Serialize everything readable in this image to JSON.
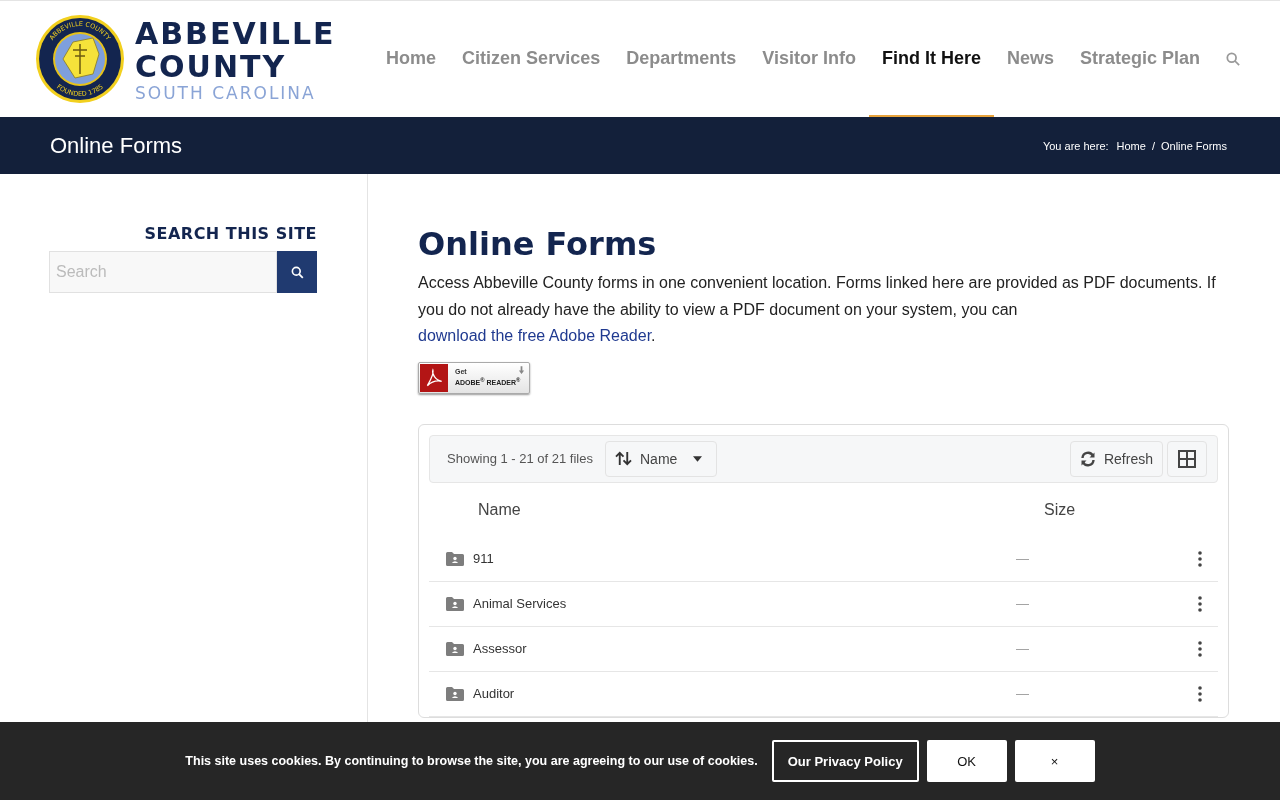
{
  "logo": {
    "seal_top": "ABBEVILLE COUNTY",
    "seal_bottom": "FOUNDED 1785",
    "line_1": "ABBEVILLE",
    "line_2": "COUNTY",
    "line_3": "SOUTH CAROLINA"
  },
  "nav": [
    {
      "label": "Home",
      "selected": false
    },
    {
      "label": "Citizen Services",
      "selected": false
    },
    {
      "label": "Departments",
      "selected": false
    },
    {
      "label": "Visitor Info",
      "selected": false
    },
    {
      "label": "Find It Here",
      "selected": true
    },
    {
      "label": "News",
      "selected": false
    },
    {
      "label": "Strategic Plan",
      "selected": false
    }
  ],
  "title_bar": {
    "title": "Online Forms",
    "breadcrumb_label": "You are here:",
    "breadcrumbs": [
      "Home",
      "Online Forms"
    ],
    "separator": "/"
  },
  "sidebar": {
    "heading": "SEARCH THIS SITE",
    "search_placeholder": "Search"
  },
  "content": {
    "heading": "Online Forms",
    "intro": "Access Abbeville County forms in one convenient location. Forms linked here are provided as PDF documents. If you do not already have the ability to view a PDF document on your system, you can ",
    "link": "download the free Adobe Reader",
    "after_link": ".",
    "adobe_badge": {
      "top": "Get",
      "bottom": "ADOBE$^{®}$ READER$^{®}$"
    }
  },
  "file_browser": {
    "count": "Showing 1 - 21 of 21 files",
    "sort": "Name",
    "refresh": "Refresh",
    "columns": [
      "Name",
      "Size"
    ],
    "rows": [
      {
        "name": "911",
        "size": "—"
      },
      {
        "name": "Animal Services",
        "size": "—"
      },
      {
        "name": "Assessor",
        "size": "—"
      },
      {
        "name": "Auditor",
        "size": "—"
      }
    ]
  },
  "cookie_bar": {
    "message": "This site uses cookies. By continuing to browse the site, you are agreeing to our use of cookies.",
    "buttons": [
      {
        "label": "Our Privacy Policy",
        "kind": "outline"
      },
      {
        "label": "OK",
        "kind": "solid"
      },
      {
        "label": "×",
        "kind": "solid"
      }
    ]
  }
}
